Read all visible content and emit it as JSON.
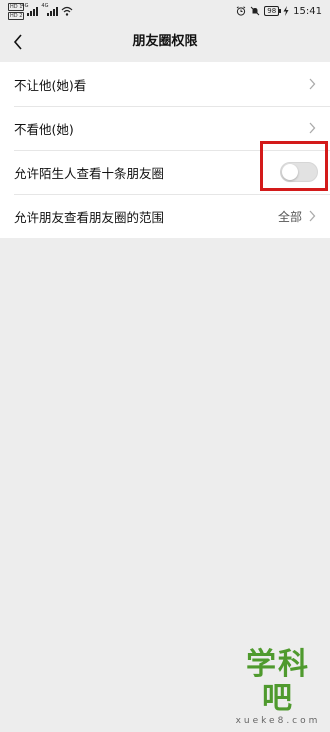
{
  "status_bar": {
    "sim1": "HD 1",
    "sim2": "HD 2",
    "network1": "4G",
    "network2": "4G",
    "battery": "98",
    "time": "15:41"
  },
  "header": {
    "title": "朋友圈权限",
    "back_icon": "chevron-left-icon"
  },
  "settings": [
    {
      "label": "不让他(她)看",
      "value": "",
      "type": "link"
    },
    {
      "label": "不看他(她)",
      "value": "",
      "type": "link"
    },
    {
      "label": "允许陌生人查看十条朋友圈",
      "type": "toggle",
      "toggle_on": false
    },
    {
      "label": "允许朋友查看朋友圈的范围",
      "value": "全部",
      "type": "link"
    }
  ],
  "watermark": {
    "title": "学科吧",
    "subtitle": "xueke8.com"
  },
  "colors": {
    "background": "#ededed",
    "highlight": "#d31a1a",
    "toggle_off": "#e2e2e2",
    "watermark": "#4f9a2e"
  }
}
